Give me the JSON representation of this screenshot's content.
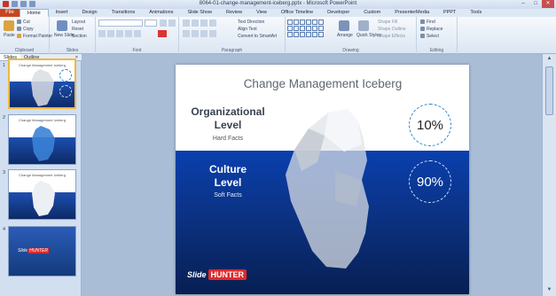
{
  "window": {
    "title": "8064-01-change-management-iceberg.pptx - Microsoft PowerPoint",
    "controls": [
      "–",
      "□",
      "✕"
    ]
  },
  "tabs": {
    "file": "File",
    "items": [
      "Home",
      "Insert",
      "Design",
      "Transitions",
      "Animations",
      "Slide Show",
      "Review",
      "View",
      "Office Timeline",
      "Developer",
      "Custom",
      "PresenterMedia",
      "PPPT",
      "Tools"
    ],
    "active": "Home"
  },
  "ribbon": {
    "clipboard": {
      "label": "Clipboard",
      "paste": "Paste",
      "cut": "Cut",
      "copy": "Copy",
      "format_painter": "Format Painter"
    },
    "slides": {
      "label": "Slides",
      "new_slide": "New Slide",
      "layout": "Layout",
      "reset": "Reset",
      "section": "Section"
    },
    "font": {
      "label": "Font"
    },
    "paragraph": {
      "label": "Paragraph",
      "text_direction": "Text Direction",
      "align_text": "Align Text",
      "convert_smartart": "Convert to SmartArt"
    },
    "drawing": {
      "label": "Drawing",
      "arrange": "Arrange",
      "quick_styles": "Quick Styles",
      "shape_fill": "Shape Fill",
      "shape_outline": "Shape Outline",
      "shape_effects": "Shape Effects"
    },
    "editing": {
      "label": "Editing",
      "find": "Find",
      "replace": "Replace",
      "select": "Select"
    }
  },
  "panel": {
    "tabs": [
      "Slides",
      "Outline"
    ],
    "close": "×",
    "thumbs": [
      {
        "num": "1",
        "title": "Change Management Iceberg",
        "selected": true
      },
      {
        "num": "2",
        "title": "Change Management Iceberg",
        "selected": false
      },
      {
        "num": "3",
        "title": "Change Management Iceberg",
        "selected": false
      },
      {
        "num": "4",
        "title": "",
        "selected": false
      }
    ]
  },
  "slide": {
    "title": "Change Management Iceberg",
    "org_line1": "Organizational",
    "org_line2": "Level",
    "org_sub": "Hard Facts",
    "org_value": "10%",
    "cult_line1": "Culture",
    "cult_line2": "Level",
    "cult_sub": "Soft Facts",
    "cult_value": "90%",
    "logo_a": "Slide",
    "logo_b": "HUNTER"
  },
  "scroll": {
    "up": "▲",
    "down": "▼"
  },
  "colors": {
    "file_tab": "#c8451f",
    "water_top": "#0a3fae",
    "water_bottom": "#081f52",
    "ring_top": "#2f86c8"
  }
}
